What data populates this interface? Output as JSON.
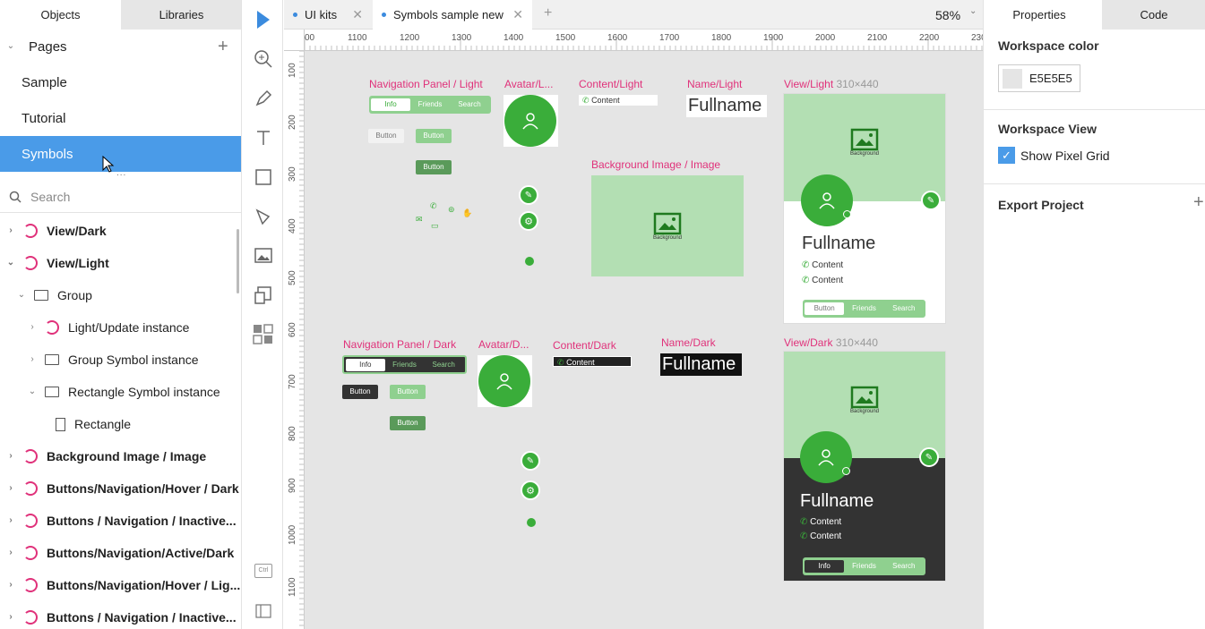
{
  "left_panel": {
    "tabs": [
      "Objects",
      "Libraries"
    ],
    "pages_title": "Pages",
    "pages": [
      "Sample",
      "Tutorial",
      "Symbols"
    ],
    "search_placeholder": "Search",
    "layers": [
      {
        "label": "View/Dark",
        "bold": true
      },
      {
        "label": "View/Light",
        "bold": true
      },
      {
        "label": "Group",
        "bold": false
      },
      {
        "label": "Light/Update instance",
        "bold": false
      },
      {
        "label": "Group Symbol instance",
        "bold": false
      },
      {
        "label": "Rectangle Symbol instance",
        "bold": false
      },
      {
        "label": "Rectangle",
        "bold": false
      },
      {
        "label": "Background Image / Image",
        "bold": true
      },
      {
        "label": "Buttons/Navigation/Hover / Dark",
        "bold": true
      },
      {
        "label": "Buttons / Navigation / Inactive...",
        "bold": true
      },
      {
        "label": "Buttons/Navigation/Active/Dark",
        "bold": true
      },
      {
        "label": "Buttons/Navigation/Hover / Lig...",
        "bold": true
      },
      {
        "label": "Buttons / Navigation / Inactive...",
        "bold": true
      }
    ]
  },
  "tools": [
    "select-icon",
    "zoom-icon",
    "pen-icon",
    "text-icon",
    "rectangle-icon",
    "path-icon",
    "image-icon",
    "symbol-icon",
    "components-icon"
  ],
  "tools_bottom": {
    "ctrl": "Ctrl"
  },
  "doc_tabs": [
    {
      "label": "UI kits"
    },
    {
      "label": "Symbols sample new"
    }
  ],
  "zoom": "58%",
  "ruler_h": [
    "00",
    "1100",
    "1200",
    "1300",
    "1400",
    "1500",
    "1600",
    "1700",
    "1800",
    "1900",
    "2000",
    "2100",
    "2200",
    "230"
  ],
  "ruler_v": [
    "100",
    "200",
    "300",
    "400",
    "500",
    "600",
    "700",
    "800",
    "900",
    "1000",
    "1100"
  ],
  "canvas": {
    "nav_light_label": "Navigation Panel / Light",
    "avatar_light_label": "Avatar/L...",
    "content_light_label": "Content/Light",
    "name_light_label": "Name/Light",
    "view_light_label": "View/Light",
    "view_light_dims": "310×440",
    "bg_image_label": "Background Image / Image",
    "nav_dark_label": "Navigation Panel / Dark",
    "avatar_dark_label": "Avatar/D...",
    "content_dark_label": "Content/Dark",
    "name_dark_label": "Name/Dark",
    "view_dark_label": "View/Dark",
    "view_dark_dims": "310×440",
    "nav_items": [
      "Info",
      "Friends",
      "Search"
    ],
    "button_text": "Button",
    "content_text": "Content",
    "fullname": "Fullname",
    "background_text": "Background"
  },
  "right_panel": {
    "tabs": [
      "Properties",
      "Code"
    ],
    "workspace_color_title": "Workspace color",
    "workspace_color_value": "E5E5E5",
    "workspace_view_title": "Workspace View",
    "show_pixel_grid": "Show Pixel Grid",
    "export_title": "Export Project"
  },
  "colors": {
    "accent": "#4a9be8",
    "green": "#3aad3a",
    "symbol": "#e0317a",
    "canvas": "#e5e5e5"
  }
}
